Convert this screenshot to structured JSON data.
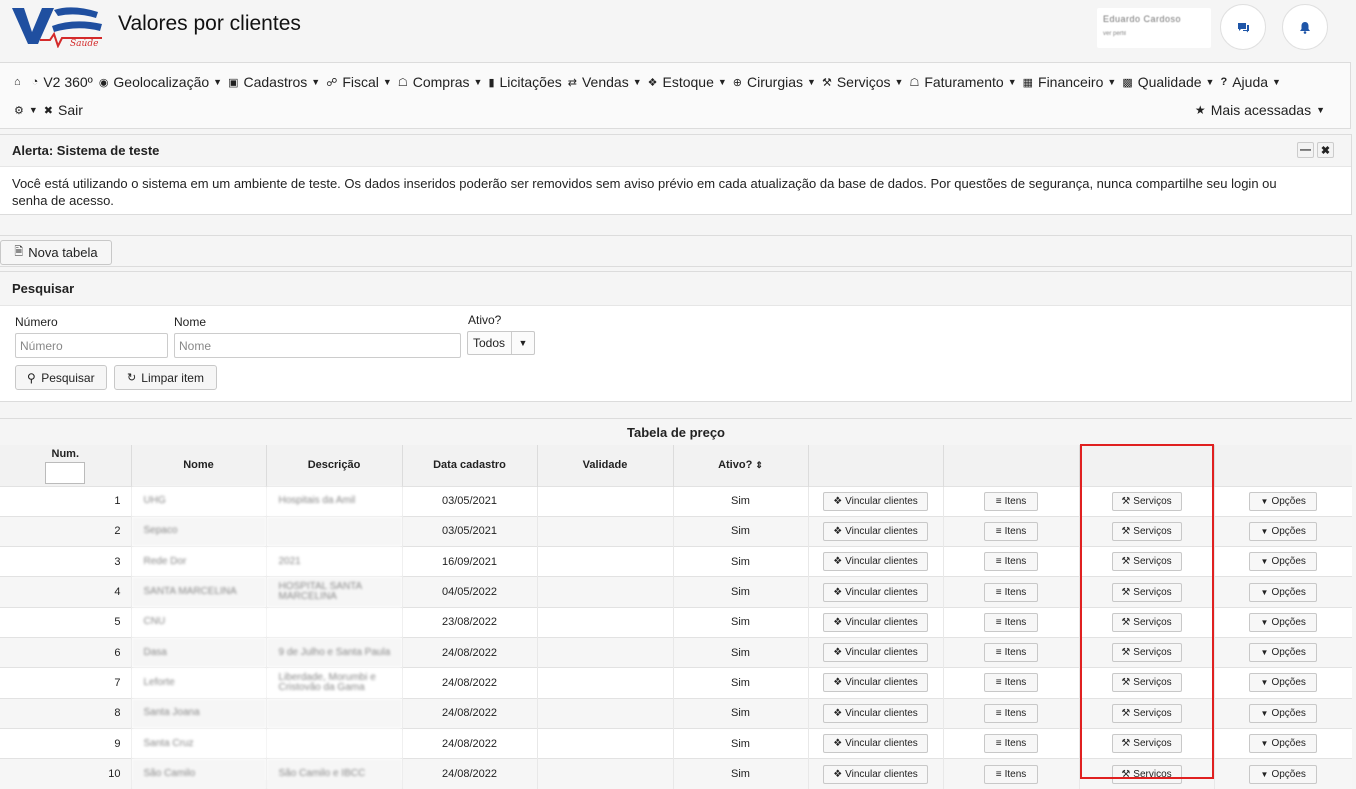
{
  "header": {
    "title": "Valores por clientes",
    "logo_text": "V2 Saúde",
    "user_name": "Eduardo Cardoso",
    "user_sub": "ver perfil"
  },
  "menu": {
    "row1": [
      {
        "icon": "home-icon",
        "label": "",
        "caret": false
      },
      {
        "icon": "v2360-icon",
        "label": "V2 360º",
        "caret": false
      },
      {
        "icon": "globe-icon",
        "label": "Geolocalização",
        "caret": true
      },
      {
        "icon": "cadastros-icon",
        "label": "Cadastros",
        "caret": true
      },
      {
        "icon": "fiscal-icon",
        "label": "Fiscal",
        "caret": true
      },
      {
        "icon": "compras-icon",
        "label": "Compras",
        "caret": true
      },
      {
        "icon": "licitacoes-icon",
        "label": "Licitações",
        "caret": false
      },
      {
        "icon": "vendas-icon",
        "label": "Vendas",
        "caret": true
      },
      {
        "icon": "tag-icon",
        "label": "Estoque",
        "caret": true
      },
      {
        "icon": "plus-circle-icon",
        "label": "Cirurgias",
        "caret": true
      },
      {
        "icon": "wrench-icon",
        "label": "Serviços",
        "caret": true
      },
      {
        "icon": "bank-icon",
        "label": "Faturamento",
        "caret": true
      },
      {
        "icon": "calc-icon",
        "label": "Financeiro",
        "caret": true
      },
      {
        "icon": "qualidade-icon",
        "label": "Qualidade",
        "caret": true
      },
      {
        "icon": "help-icon",
        "label": "Ajuda",
        "caret": true
      }
    ],
    "row2_sair": "Sair",
    "mais": "Mais acessadas"
  },
  "alert": {
    "title": "Alerta: Sistema de teste",
    "text": "Você está utilizando o sistema em um ambiente de teste. Os dados inseridos poderão ser removidos sem aviso prévio em cada atualização da base de dados. Por questões de segurança, nunca compartilhe seu login ou senha de acesso."
  },
  "toolbar": {
    "new_table": "Nova tabela"
  },
  "search": {
    "title": "Pesquisar",
    "numero_label": "Número",
    "numero_placeholder": "Número",
    "nome_label": "Nome",
    "nome_placeholder": "Nome",
    "ativo_label": "Ativo?",
    "ativo_value": "Todos",
    "search_button": "Pesquisar",
    "clear_button": "Limpar item"
  },
  "table": {
    "caption": "Tabela de preço",
    "headers": [
      "Num.",
      "Nome",
      "Descrição",
      "Data cadastro",
      "Validade",
      "Ativo?",
      "",
      "",
      "",
      ""
    ],
    "btn_vincular": "Vincular clientes",
    "btn_itens": "Itens",
    "btn_servicos": "Serviços",
    "btn_opcoes": "Opções",
    "rows": [
      {
        "num": "1",
        "nome": "UHG",
        "descricao": "Hospitais da Amil",
        "data": "03/05/2021",
        "validade": "",
        "ativo": "Sim"
      },
      {
        "num": "2",
        "nome": "Sepaco",
        "descricao": "",
        "data": "03/05/2021",
        "validade": "",
        "ativo": "Sim"
      },
      {
        "num": "3",
        "nome": "Rede Dor",
        "descricao": "2021",
        "data": "16/09/2021",
        "validade": "",
        "ativo": "Sim"
      },
      {
        "num": "4",
        "nome": "SANTA MARCELINA",
        "descricao": "HOSPITAL SANTA MARCELINA",
        "data": "04/05/2022",
        "validade": "",
        "ativo": "Sim"
      },
      {
        "num": "5",
        "nome": "CNU",
        "descricao": "",
        "data": "23/08/2022",
        "validade": "",
        "ativo": "Sim"
      },
      {
        "num": "6",
        "nome": "Dasa",
        "descricao": "9 de Julho e Santa Paula",
        "data": "24/08/2022",
        "validade": "",
        "ativo": "Sim"
      },
      {
        "num": "7",
        "nome": "Leforte",
        "descricao": "Liberdade, Morumbi e Cristovão da Gama",
        "data": "24/08/2022",
        "validade": "",
        "ativo": "Sim"
      },
      {
        "num": "8",
        "nome": "Santa Joana",
        "descricao": "",
        "data": "24/08/2022",
        "validade": "",
        "ativo": "Sim"
      },
      {
        "num": "9",
        "nome": "Santa Cruz",
        "descricao": "",
        "data": "24/08/2022",
        "validade": "",
        "ativo": "Sim"
      },
      {
        "num": "10",
        "nome": "São Camilo",
        "descricao": "São Camilo e IBCC",
        "data": "24/08/2022",
        "validade": "",
        "ativo": "Sim"
      }
    ]
  }
}
